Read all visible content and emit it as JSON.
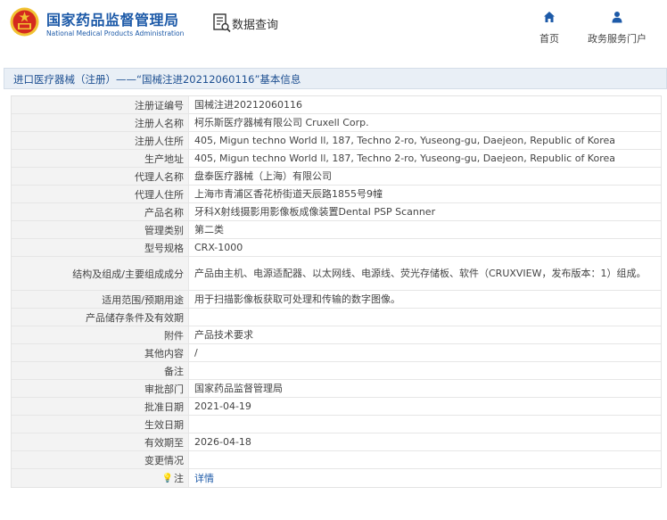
{
  "header": {
    "brand_cn": "国家药品监督管理局",
    "brand_en": "National Medical Products Administration",
    "section_title": "数据查询",
    "nav": {
      "home_label": "首页",
      "service_label": "政务服务门户"
    }
  },
  "breadcrumb": {
    "text": "进口医疗器械（注册）——“国械注进20212060116”基本信息"
  },
  "colors": {
    "brand_blue": "#1d5aa8",
    "emblem_red": "#d42a1e",
    "emblem_gold": "#f1c232"
  },
  "details": [
    {
      "label": "注册证编号",
      "value": "国械注进20212060116"
    },
    {
      "label": "注册人名称",
      "value": "柯乐斯医疗器械有限公司 Cruxell Corp."
    },
    {
      "label": "注册人住所",
      "value": "405, Migun techno World ll, 187, Techno 2-ro, Yuseong-gu, Daejeon, Republic of Korea"
    },
    {
      "label": "生产地址",
      "value": "405, Migun techno World ll, 187, Techno 2-ro, Yuseong-gu, Daejeon, Republic of Korea"
    },
    {
      "label": "代理人名称",
      "value": "盘泰医疗器械（上海）有限公司"
    },
    {
      "label": "代理人住所",
      "value": "上海市青浦区香花桥街道天辰路1855号9幢"
    },
    {
      "label": "产品名称",
      "value": "牙科X射线摄影用影像板成像装置Dental PSP Scanner"
    },
    {
      "label": "管理类别",
      "value": "第二类"
    },
    {
      "label": "型号规格",
      "value": "CRX-1000"
    },
    {
      "label": "结构及组成/主要组成成分",
      "value": "产品由主机、电源适配器、以太网线、电源线、荧光存储板、软件（CRUXVIEW，发布版本：1）组成。"
    },
    {
      "label": "适用范围/预期用途",
      "value": "用于扫描影像板获取可处理和传输的数字图像。"
    },
    {
      "label": "产品储存条件及有效期",
      "value": ""
    },
    {
      "label": "附件",
      "value": "产品技术要求"
    },
    {
      "label": "其他内容",
      "value": "/"
    },
    {
      "label": "备注",
      "value": ""
    },
    {
      "label": "审批部门",
      "value": "国家药品监督管理局"
    },
    {
      "label": "批准日期",
      "value": "2021-04-19"
    },
    {
      "label": "生效日期",
      "value": ""
    },
    {
      "label": "有效期至",
      "value": "2026-04-18"
    },
    {
      "label": "变更情况",
      "value": ""
    },
    {
      "label": "注",
      "value": "详情"
    }
  ]
}
